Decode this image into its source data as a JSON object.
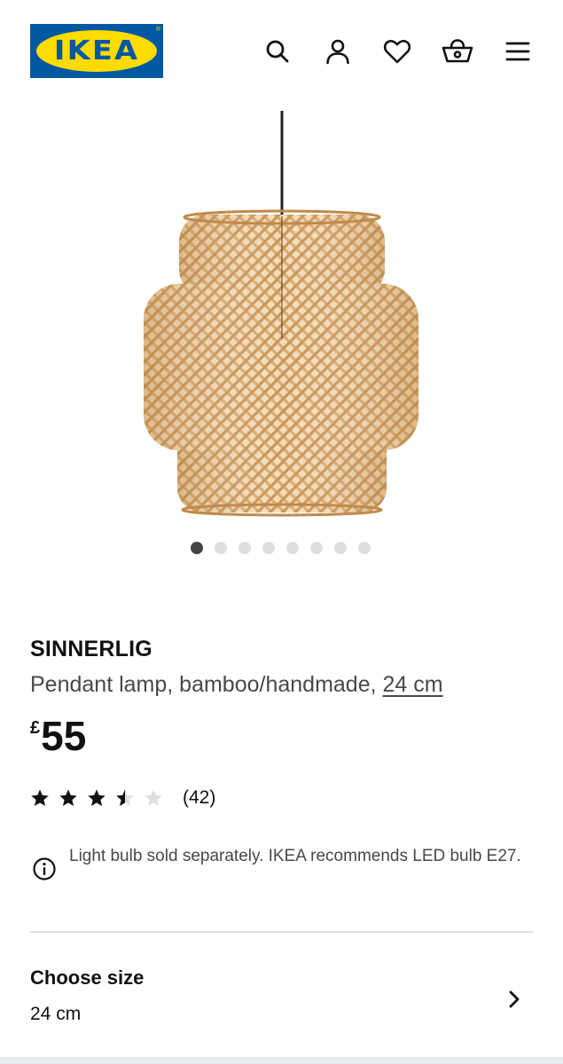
{
  "header": {
    "logo_text": "IKEA",
    "logo_reg": "®",
    "icons": [
      "search-icon",
      "account-icon",
      "favourites-icon",
      "basket-icon",
      "menu-icon"
    ]
  },
  "carousel": {
    "total": 8,
    "active_index": 0
  },
  "product": {
    "name": "SINNERLIG",
    "description": "Pendant lamp, bamboo/handmade,",
    "size_link": "24 cm",
    "price_currency": "£",
    "price_amount": "55",
    "rating_value": 3.5,
    "rating_max": 5,
    "review_count": "(42)",
    "notice": "Light bulb sold separately. IKEA recommends LED bulb E27."
  },
  "size_selector": {
    "label": "Choose size",
    "value": "24 cm"
  },
  "colors": {
    "brand_blue": "#0058a3",
    "brand_yellow": "#ffdb00",
    "text_primary": "#111111",
    "text_secondary": "#484848",
    "dot_active": "#444444",
    "dot_inactive": "#dfdfdf",
    "divider": "#dfdfdf"
  }
}
